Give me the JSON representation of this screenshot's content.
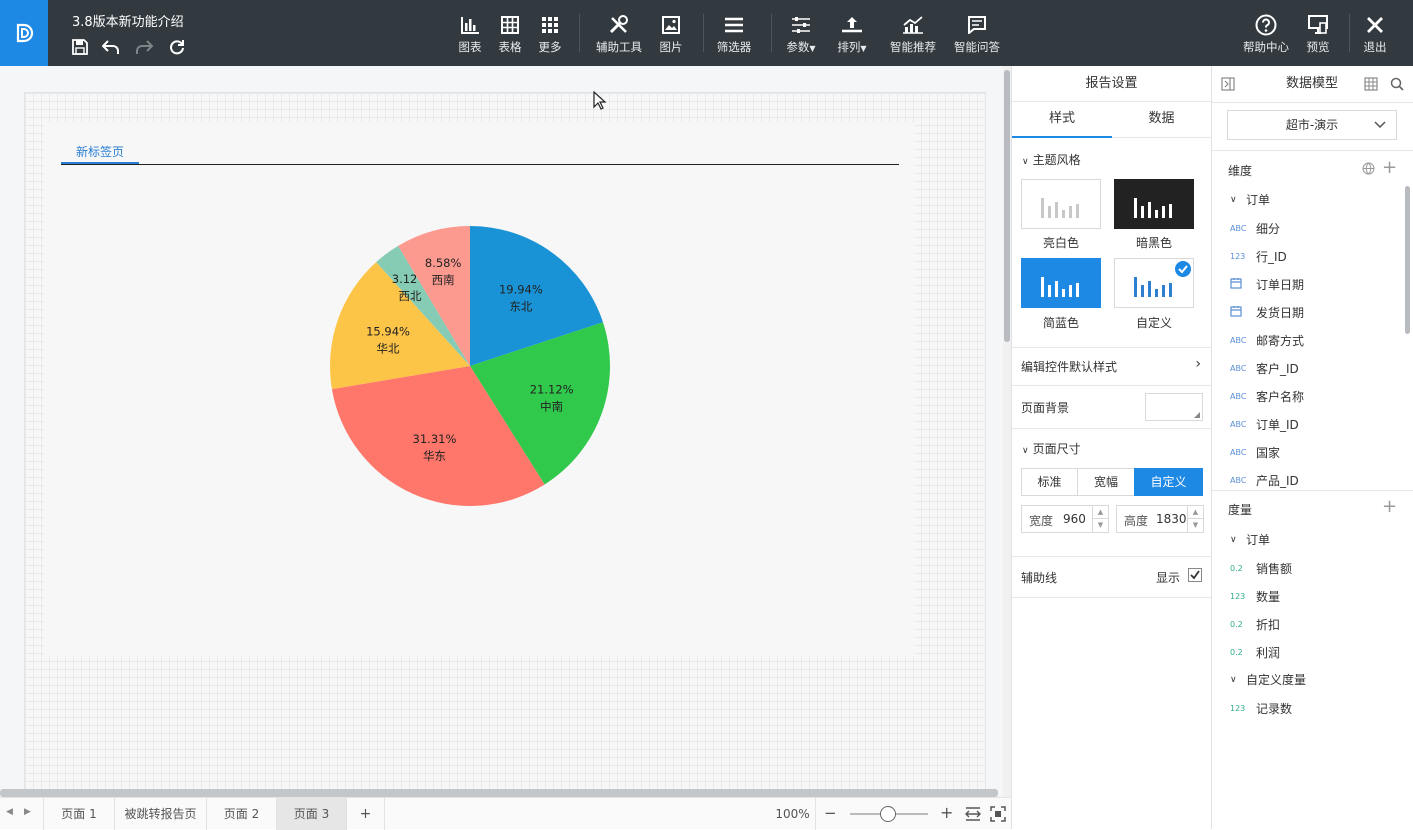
{
  "header": {
    "doc_title": "3.8版本新功能介绍",
    "toolbar": [
      {
        "label": "图表",
        "icon": "bar-chart-icon"
      },
      {
        "label": "表格",
        "icon": "table-icon"
      },
      {
        "label": "更多",
        "icon": "grid-more-icon"
      },
      {
        "label": "辅助工具",
        "icon": "tools-icon"
      },
      {
        "label": "图片",
        "icon": "image-icon"
      },
      {
        "label": "筛选器",
        "icon": "filter-list-icon"
      },
      {
        "label": "参数",
        "icon": "sliders-icon"
      },
      {
        "label": "排列",
        "icon": "arrange-icon"
      },
      {
        "label": "智能推荐",
        "icon": "smart-recommend-icon"
      },
      {
        "label": "智能问答",
        "icon": "chat-icon"
      }
    ],
    "right": [
      {
        "label": "帮助中心",
        "icon": "help-icon"
      },
      {
        "label": "预览",
        "icon": "preview-icon"
      },
      {
        "label": "退出",
        "icon": "close-icon"
      }
    ]
  },
  "canvas": {
    "tab_label": "新标签页"
  },
  "chart_data": {
    "type": "pie",
    "title": "",
    "slices": [
      {
        "label": "东北",
        "value": 19.94,
        "text": "19.94%",
        "color": "#1a93d6"
      },
      {
        "label": "中南",
        "value": 21.12,
        "text": "21.12%",
        "color": "#31c94c"
      },
      {
        "label": "华东",
        "value": 31.31,
        "text": "31.31%",
        "color": "#ff776a"
      },
      {
        "label": "华北",
        "value": 15.94,
        "text": "15.94%",
        "color": "#fdc548"
      },
      {
        "label": "西北",
        "value": 3.12,
        "text": "3.12%",
        "color": "#86cbb4"
      },
      {
        "label": "西南",
        "value": 8.58,
        "text": "8.58%",
        "color": "#fd9a8f"
      }
    ]
  },
  "bottom": {
    "pages": [
      "页面 1",
      "被跳转报告页",
      "页面 2",
      "页面 3"
    ],
    "active_page": "页面 3",
    "add_label": "+",
    "zoom": "100%",
    "zoom_minus": "−",
    "zoom_plus": "+"
  },
  "settings": {
    "title": "报告设置",
    "tabs": [
      "样式",
      "数据"
    ],
    "theme_section": "主题风格",
    "themes": [
      "亮白色",
      "暗黑色",
      "简蓝色",
      "自定义"
    ],
    "edit_default_style": "编辑控件默认样式",
    "page_background": "页面背景",
    "page_size": "页面尺寸",
    "size_options": [
      "标准",
      "宽幅",
      "自定义"
    ],
    "width_label": "宽度",
    "width_value": "960",
    "height_label": "高度",
    "height_value": "1830",
    "guide_label": "辅助线",
    "guide_show": "显示"
  },
  "model": {
    "title": "数据模型",
    "dataset": "超市-演示",
    "dimension_title": "维度",
    "dimension_group": "订单",
    "dimensions": [
      {
        "type": "ABC",
        "name": "细分"
      },
      {
        "type": "123",
        "name": "行_ID"
      },
      {
        "type": "date",
        "name": "订单日期"
      },
      {
        "type": "date",
        "name": "发货日期"
      },
      {
        "type": "ABC",
        "name": "邮寄方式"
      },
      {
        "type": "ABC",
        "name": "客户_ID"
      },
      {
        "type": "ABC",
        "name": "客户名称"
      },
      {
        "type": "ABC",
        "name": "订单_ID"
      },
      {
        "type": "ABC",
        "name": "国家"
      },
      {
        "type": "ABC",
        "name": "产品_ID"
      }
    ],
    "measure_title": "度量",
    "measure_group": "订单",
    "measures": [
      {
        "type": "0.2",
        "name": "销售额"
      },
      {
        "type": "123",
        "name": "数量"
      },
      {
        "type": "0.2",
        "name": "折扣"
      },
      {
        "type": "0.2",
        "name": "利润"
      }
    ],
    "custom_group": "自定义度量",
    "custom_measures": [
      {
        "type": "123",
        "name": "记录数"
      }
    ]
  }
}
